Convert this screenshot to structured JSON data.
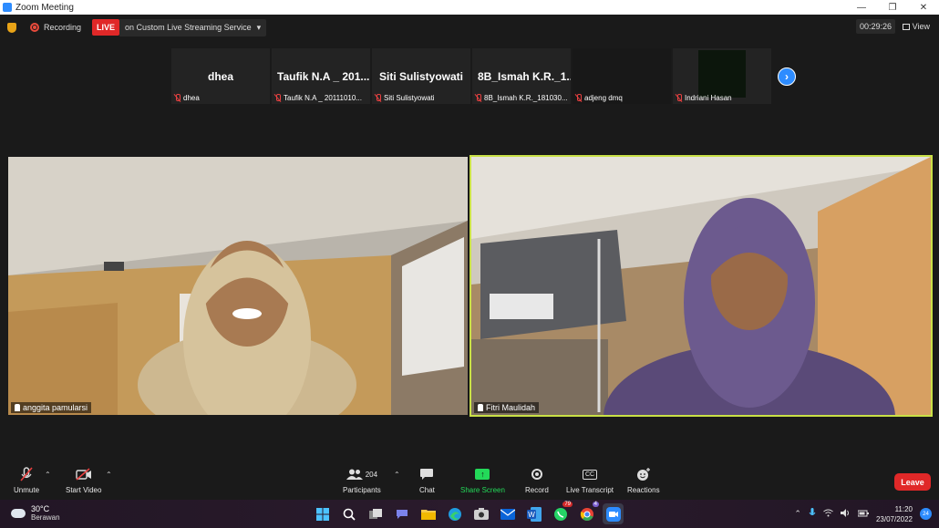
{
  "window": {
    "title": "Zoom Meeting"
  },
  "topbar": {
    "recording_label": "Recording",
    "live_label": "LIVE",
    "stream_label": "on Custom Live Streaming Service",
    "timer": "00:29:26",
    "view_label": "View"
  },
  "thumbnails": [
    {
      "display": "dhea",
      "name": "dhea"
    },
    {
      "display": "Taufik N.A _ 201...",
      "name": "Taufik N.A _ 20111010..."
    },
    {
      "display": "Siti Sulistyowati",
      "name": "Siti Sulistyowati"
    },
    {
      "display": "8B_Ismah K.R._1...",
      "name": "8B_Ismah K.R._181030..."
    },
    {
      "display": "",
      "name": "adjeng dmq"
    },
    {
      "display": "",
      "name": "Indriani Hasan"
    }
  ],
  "videos": {
    "left_name": "anggita pamularsi",
    "right_name": "Fitri Maulidah"
  },
  "toolbar": {
    "unmute": "Unmute",
    "start_video": "Start Video",
    "participants_count": "204",
    "participants": "Participants",
    "chat": "Chat",
    "share_screen": "Share Screen",
    "record": "Record",
    "live_transcript": "Live Transcript",
    "reactions": "Reactions",
    "leave": "Leave"
  },
  "taskbar": {
    "temperature": "30°C",
    "weather": "Berawan",
    "whatsapp_badge": "79",
    "chrome_badge": "4",
    "time": "11:20",
    "date": "23/07/2022",
    "notifications": "24"
  },
  "colors": {
    "active_speaker_border": "#c9e046",
    "live_red": "#e02828",
    "share_green": "#23d959",
    "zoom_blue": "#2d8cff"
  }
}
